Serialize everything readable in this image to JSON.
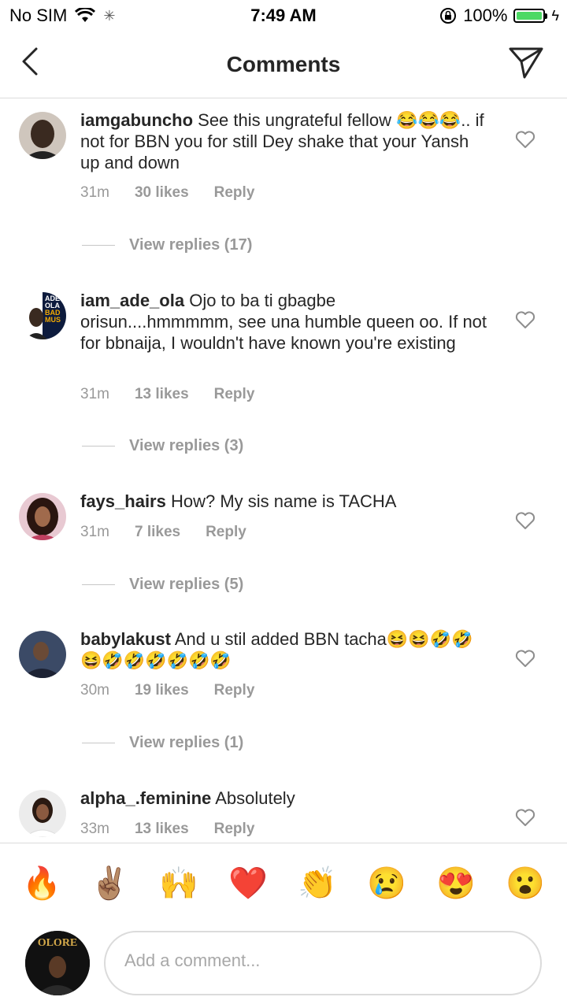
{
  "status": {
    "carrier": "No SIM",
    "time": "7:49 AM",
    "battery": "100%"
  },
  "header": {
    "title": "Comments"
  },
  "comments": [
    {
      "user": "iamgabuncho",
      "text": "See this ungrateful fellow 😂😂😂.. if not for BBN you for still Dey shake that your Yansh up and down",
      "time": "31m",
      "likes": "30 likes",
      "reply": "Reply",
      "view_replies": "View replies (17)"
    },
    {
      "user": "iam_ade_ola",
      "text": "Ojo to ba ti gbagbe orisun....hmmmmm, see una humble queen oo. If not for bbnaija, I wouldn't have known you're existing",
      "time": "31m",
      "likes": "13 likes",
      "reply": "Reply",
      "view_replies": "View replies (3)",
      "avatar_text": [
        "ADE",
        "OLA",
        "BAD",
        "MUS"
      ]
    },
    {
      "user": "fays_hairs",
      "text": "How? My sis name is TACHA",
      "time": "31m",
      "likes": "7 likes",
      "reply": "Reply",
      "view_replies": "View replies (5)"
    },
    {
      "user": "babylakust",
      "text": "And u stil added BBN tacha😆😆🤣🤣😆🤣🤣🤣🤣🤣🤣",
      "time": "30m",
      "likes": "19 likes",
      "reply": "Reply",
      "view_replies": "View replies (1)"
    },
    {
      "user": "alpha_.feminine",
      "text": "Absolutely",
      "time": "33m",
      "likes": "13 likes",
      "reply": "Reply"
    }
  ],
  "emoji_bar": [
    "🔥",
    "✌🏽",
    "🙌",
    "❤️",
    "👏",
    "😢",
    "😍",
    "😮"
  ],
  "composer": {
    "placeholder": "Add a comment...",
    "avatar_text": "OLORE"
  },
  "colors": {
    "text": "#262626",
    "meta": "#999999",
    "divider": "#dbdbdb",
    "battery": "#4cd964"
  }
}
